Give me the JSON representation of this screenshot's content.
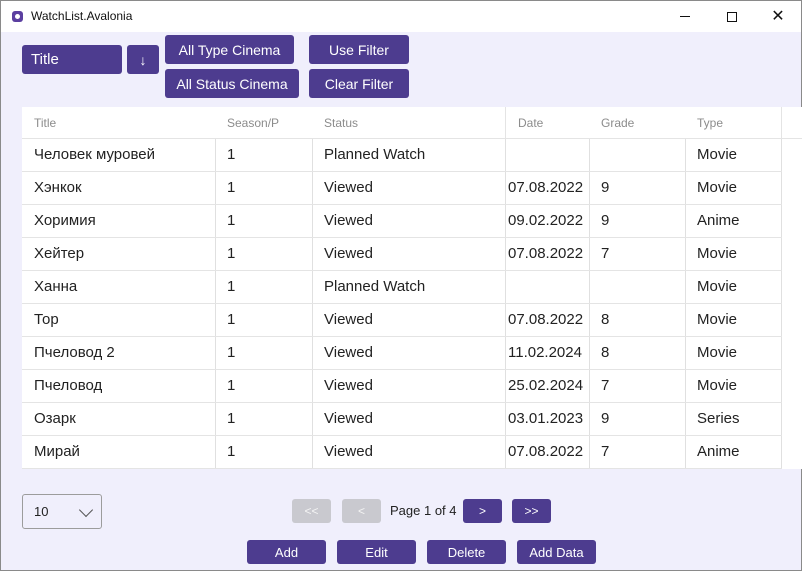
{
  "window": {
    "title": "WatchList.Avalonia"
  },
  "toolbar": {
    "sort_field": "Title",
    "sort_direction_glyph": "↓",
    "type_filter": "All Type Cinema",
    "status_filter": "All Status Cinema",
    "use_filter": "Use Filter",
    "clear_filter": "Clear Filter"
  },
  "table": {
    "columns": [
      "Title",
      "Season/P",
      "Status",
      "Date",
      "Grade",
      "Type"
    ],
    "rows": [
      [
        "Человек муровей",
        "1",
        "Planned Watch",
        "",
        "",
        "Movie"
      ],
      [
        "Хэнкок",
        "1",
        "Viewed",
        "07.08.2022",
        "9",
        "Movie"
      ],
      [
        "Хоримия",
        "1",
        "Viewed",
        "09.02.2022",
        "9",
        "Anime"
      ],
      [
        "Хейтер",
        "1",
        "Viewed",
        "07.08.2022",
        "7",
        "Movie"
      ],
      [
        "Ханна",
        "1",
        "Planned Watch",
        "",
        "",
        "Movie"
      ],
      [
        "Тор",
        "1",
        "Viewed",
        "07.08.2022",
        "8",
        "Movie"
      ],
      [
        "Пчеловод 2",
        "1",
        "Viewed",
        "11.02.2024",
        "8",
        "Movie"
      ],
      [
        "Пчеловод",
        "1",
        "Viewed",
        "25.02.2024",
        "7",
        "Movie"
      ],
      [
        "Озарк",
        "1",
        "Viewed",
        "03.01.2023",
        "9",
        "Series"
      ],
      [
        "Мирай",
        "1",
        "Viewed",
        "07.08.2022",
        "7",
        "Anime"
      ]
    ]
  },
  "pagination": {
    "page_size": "10",
    "first": "<<",
    "prev": "<",
    "page_info": "Page 1 of 4",
    "next": ">",
    "last": ">>"
  },
  "actions": {
    "add": "Add",
    "edit": "Edit",
    "delete": "Delete",
    "add_data": "Add Data"
  },
  "colors": {
    "accent": "#4d3c8f",
    "background": "#f0effc",
    "disabled": "#c9c9cf"
  }
}
